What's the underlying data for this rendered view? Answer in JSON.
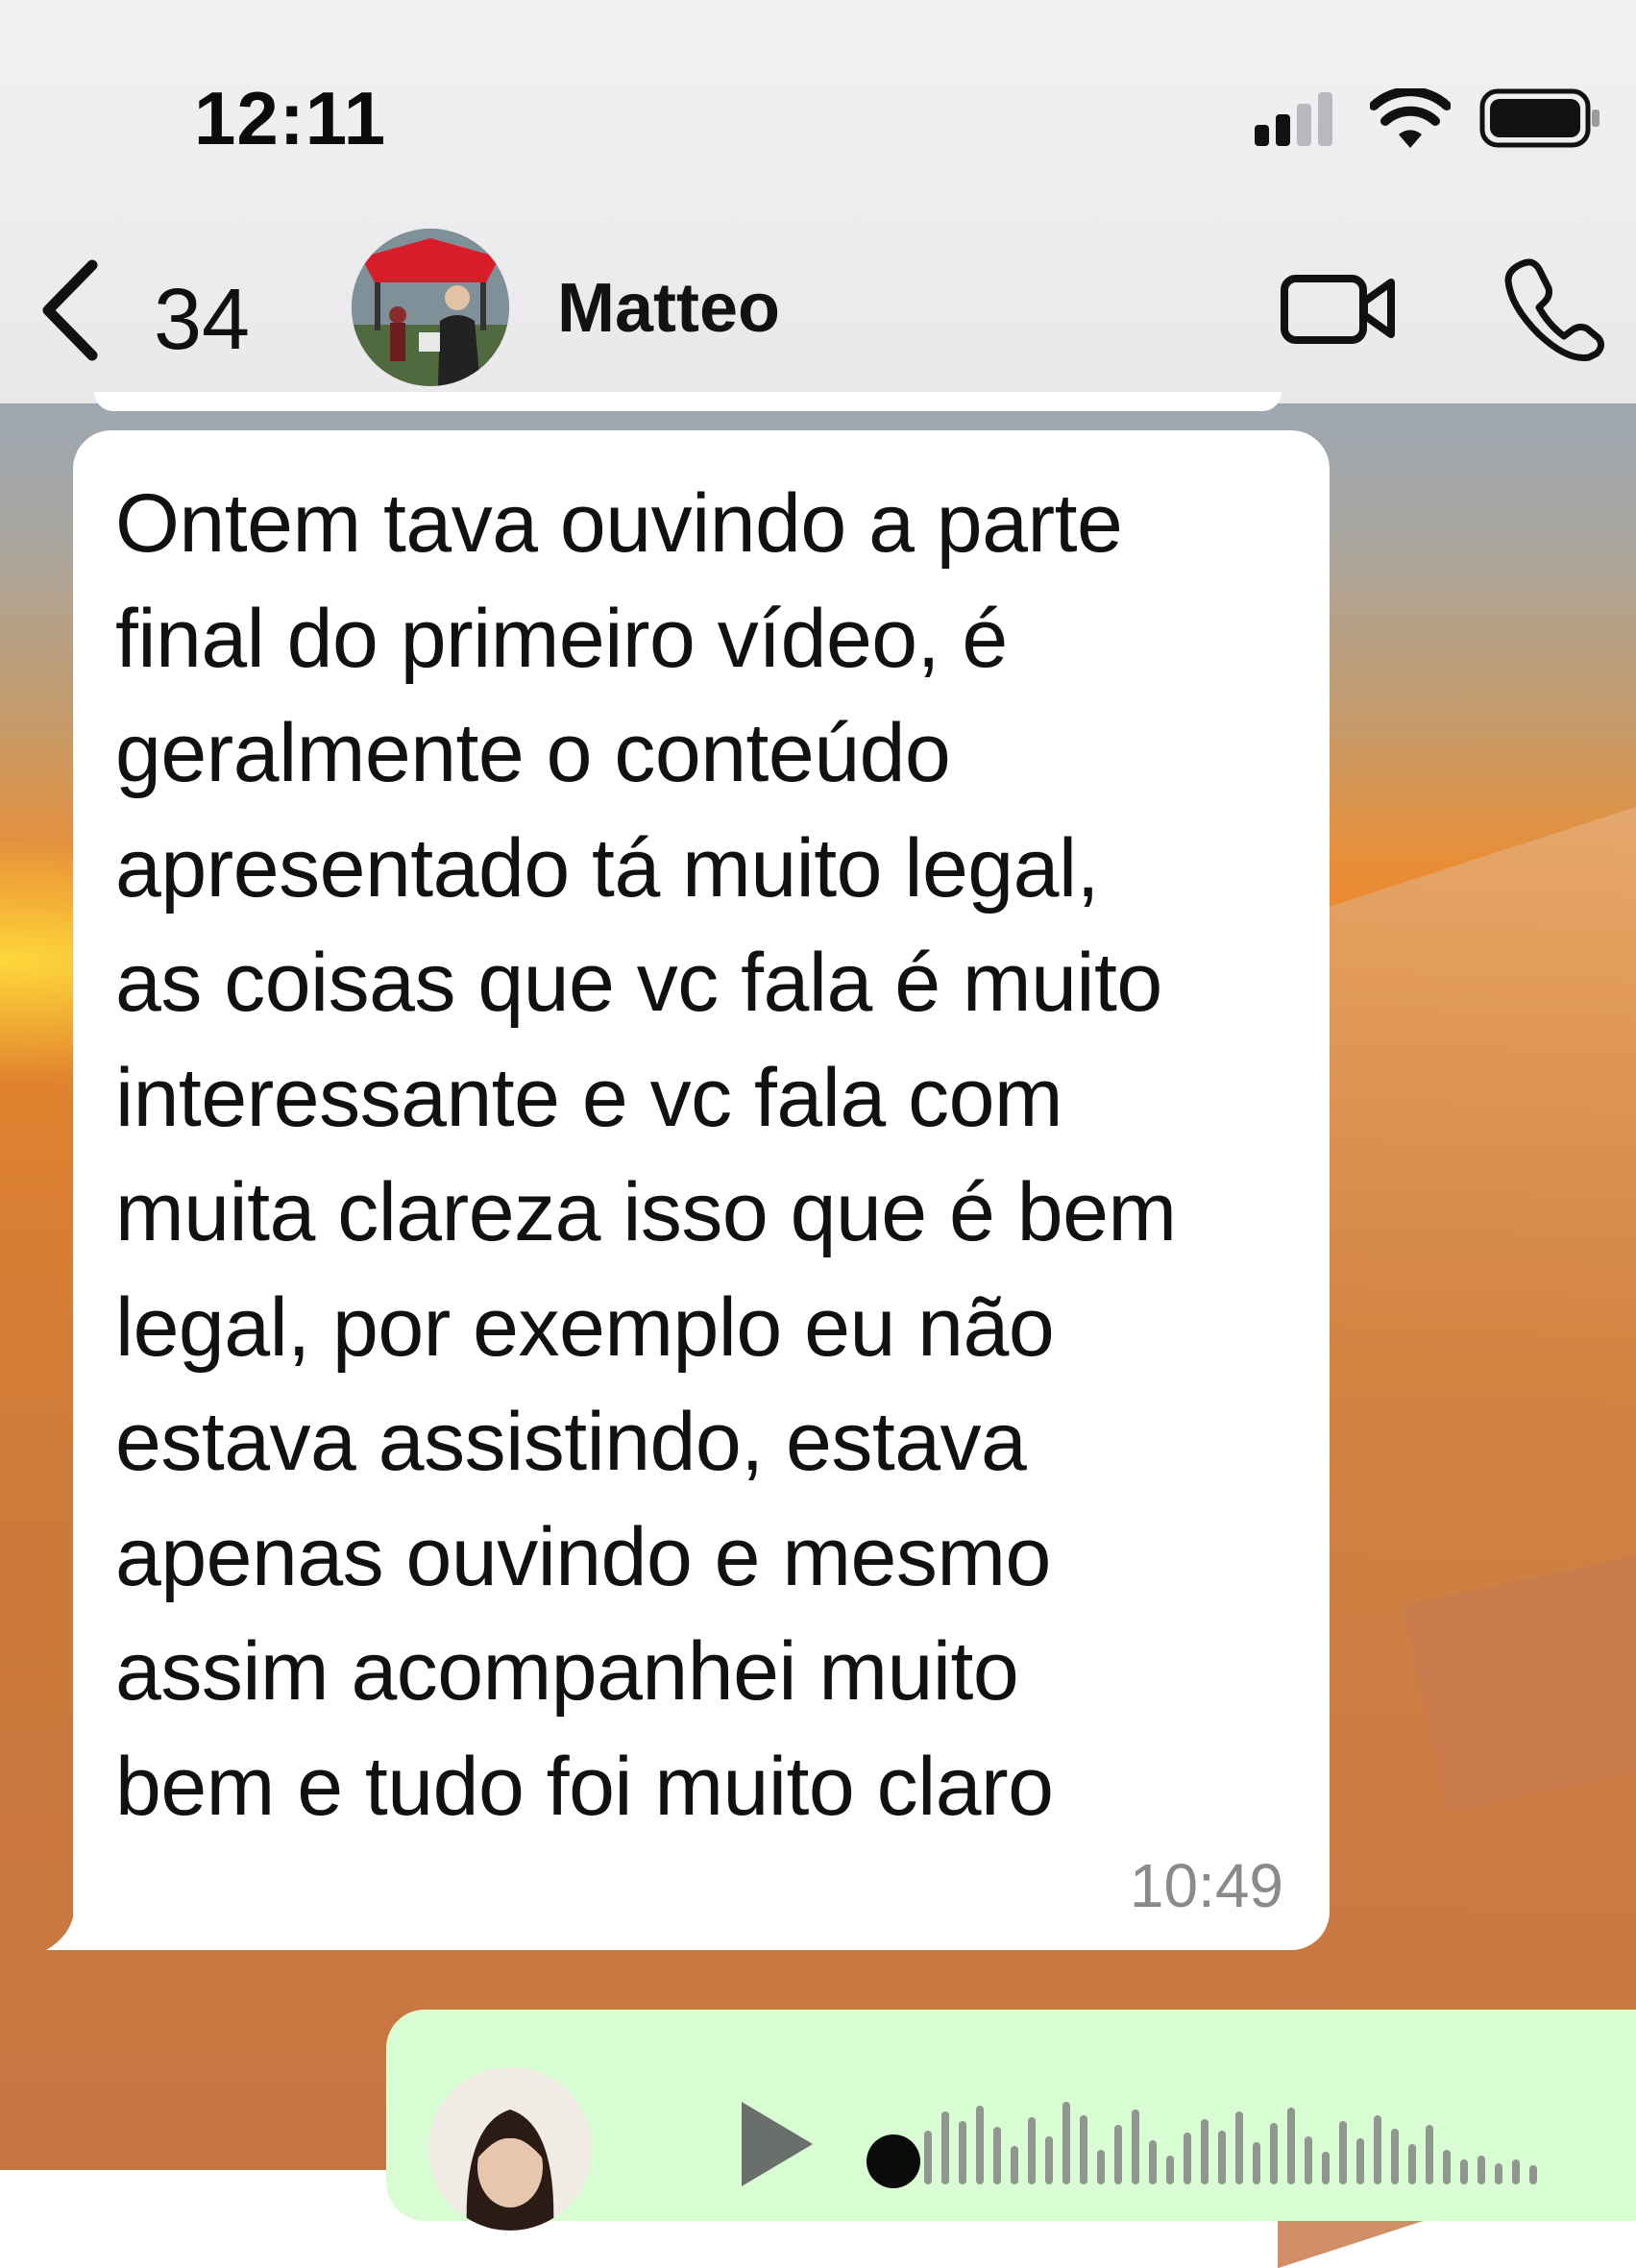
{
  "status_bar": {
    "time": "12:11",
    "icons": [
      "signal-icon",
      "wifi-icon",
      "battery-icon"
    ]
  },
  "header": {
    "back_icon": "chevron-left-icon",
    "back_count": "34",
    "contact_name": "Matteo",
    "actions": [
      "video-camera-icon",
      "phone-icon"
    ]
  },
  "messages": [
    {
      "direction": "incoming",
      "lines": [
        "Ontem tava ouvindo a parte",
        "final do primeiro vídeo, é",
        "geralmente o conteúdo",
        "apresentado tá muito legal,",
        "as coisas que vc fala é muito",
        "interessante e vc fala com",
        "muita clareza isso que é bem",
        "legal, por exemplo eu não",
        "estava assistindo, estava",
        "apenas ouvindo e mesmo",
        "assim acompanhei muito",
        "bem e tudo foi muito claro"
      ],
      "time": "10:49"
    },
    {
      "direction": "outgoing",
      "type": "voice-note",
      "icons": [
        "play-icon",
        "waveform-icon"
      ]
    }
  ],
  "colors": {
    "incoming_bubble": "#ffffff",
    "outgoing_bubble": "#d9fdd3",
    "header_bg": "#f1f1f3",
    "timestamp": "#8a8a8a"
  }
}
